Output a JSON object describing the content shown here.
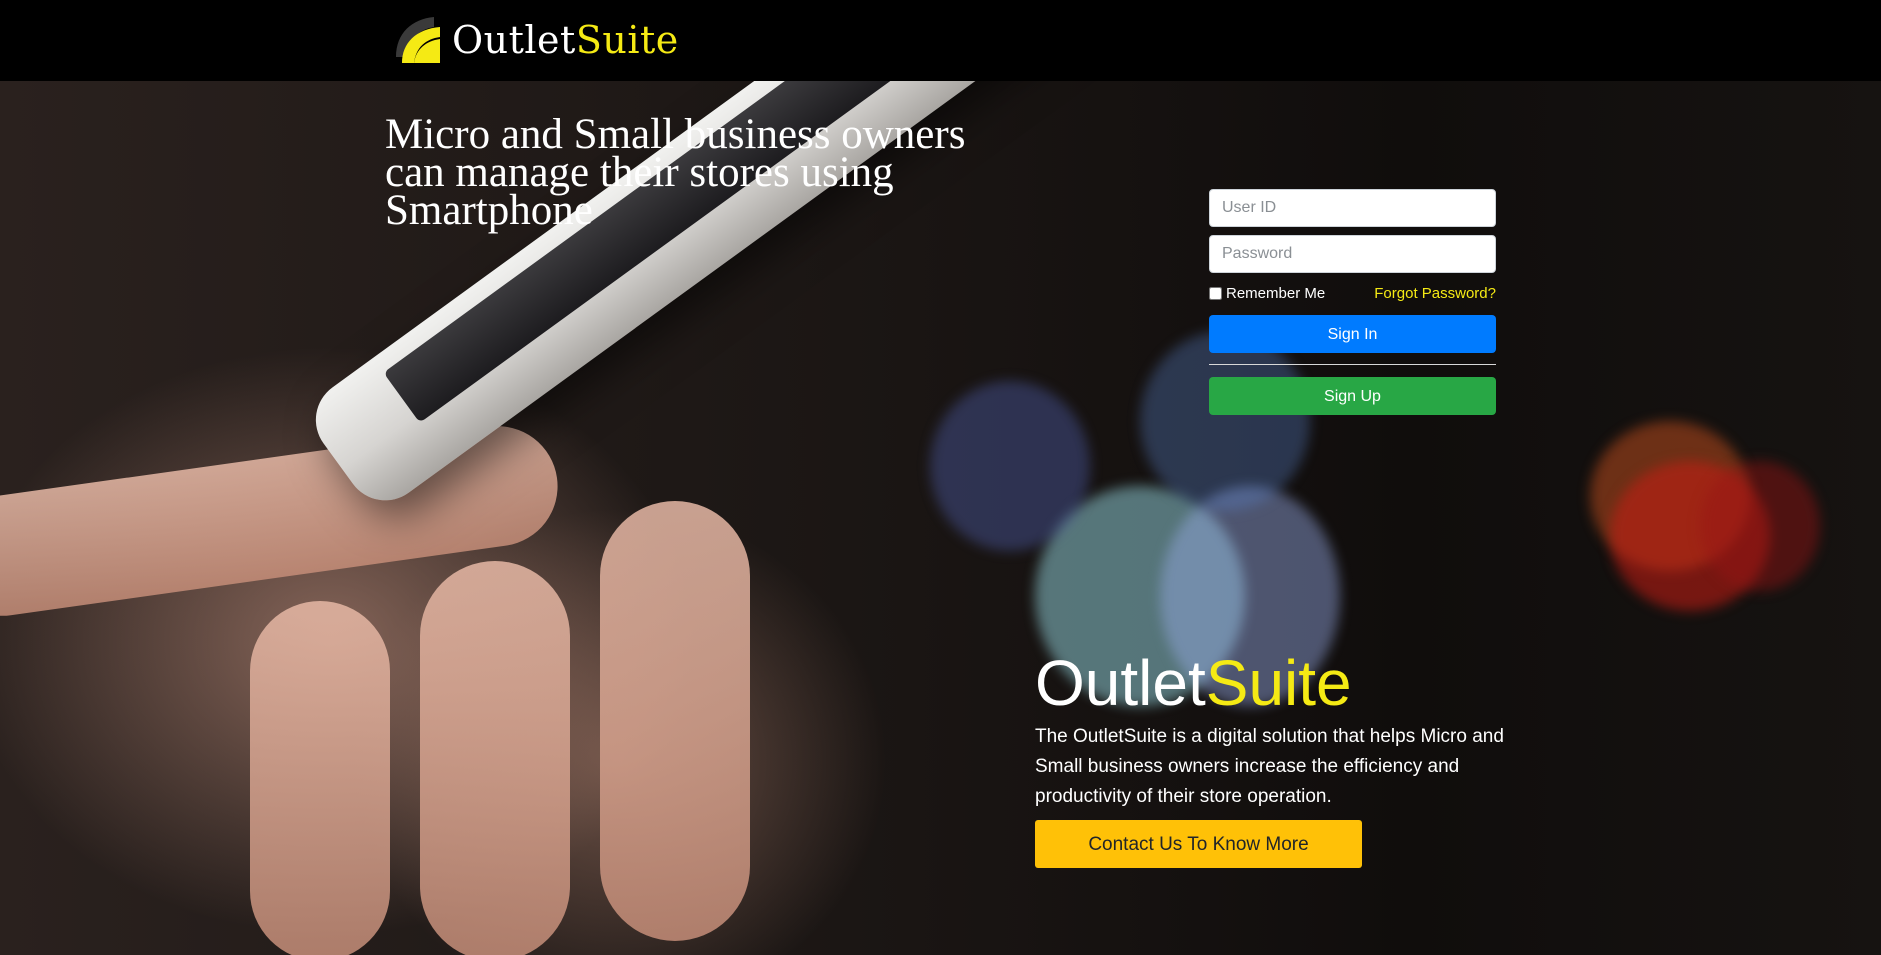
{
  "header": {
    "logo_text_part1": "Outlet",
    "logo_text_part2": "Suite",
    "logo_icon": "swirl-logo-icon"
  },
  "hero": {
    "headline": "Micro and Small business owners can manage their stores using Smartphone"
  },
  "login": {
    "user_id_placeholder": "User ID",
    "password_placeholder": "Password",
    "remember_label": "Remember Me",
    "forgot_label": "Forgot Password?",
    "sign_in_label": "Sign In",
    "sign_up_label": "Sign Up"
  },
  "brand": {
    "title_part1": "Outlet",
    "title_part2": "Suite",
    "description": "The OutletSuite is a digital solution that helps Micro and Small business owners increase the efficiency and productivity of their store operation.",
    "contact_label": "Contact Us To Know More"
  },
  "colors": {
    "accent_yellow": "#f5ea14",
    "primary_blue": "#007bff",
    "success_green": "#28a745",
    "warning_yellow": "#ffc107",
    "topbar_bg": "#000000"
  }
}
